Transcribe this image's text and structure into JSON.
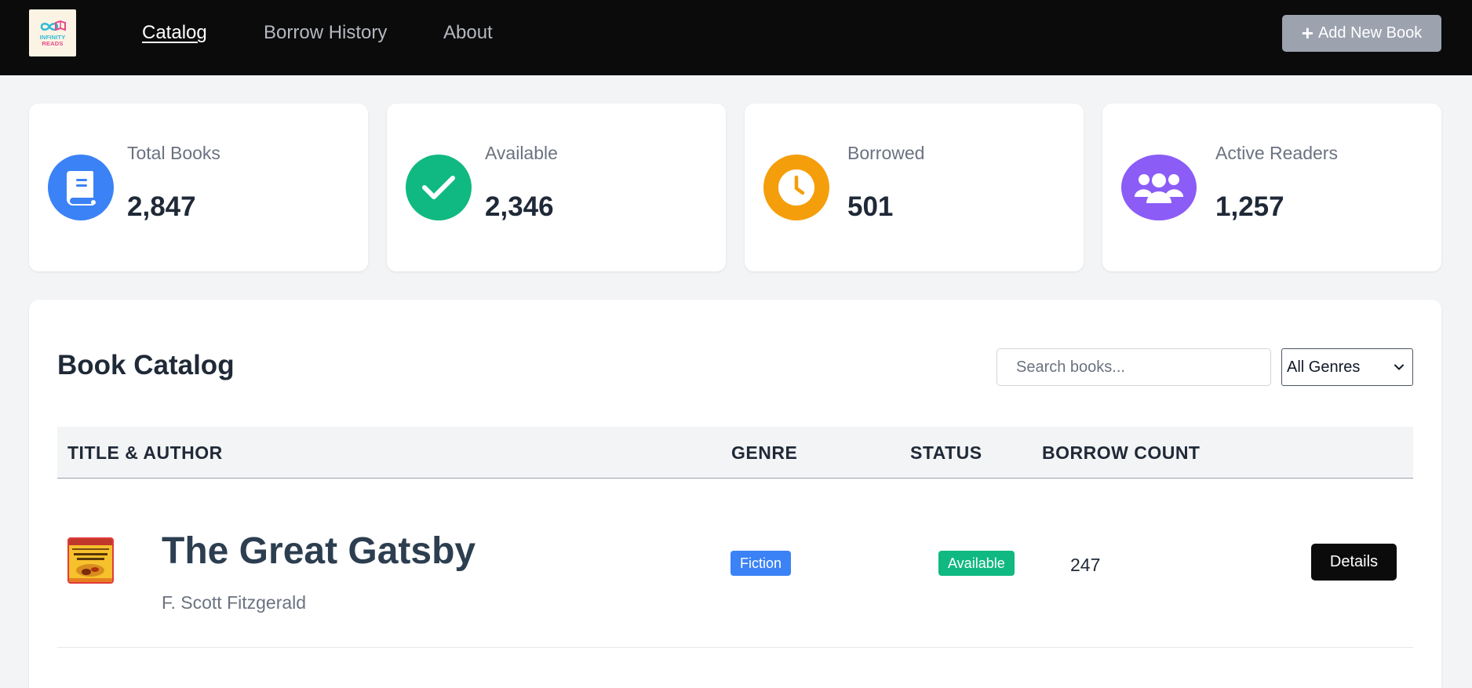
{
  "header": {
    "logo": {
      "line1": "INFINITY",
      "line2": "READS"
    },
    "nav": [
      {
        "label": "Catalog",
        "active": true
      },
      {
        "label": "Borrow History",
        "active": false
      },
      {
        "label": "About",
        "active": false
      }
    ],
    "add_button_label": "Add New Book"
  },
  "stats": [
    {
      "label": "Total Books",
      "value": "2,847",
      "icon": "book-icon",
      "color": "#3b82f6"
    },
    {
      "label": "Available",
      "value": "2,346",
      "icon": "check-icon",
      "color": "#10b981"
    },
    {
      "label": "Borrowed",
      "value": "501",
      "icon": "clock-icon",
      "color": "#f59e0b"
    },
    {
      "label": "Active Readers",
      "value": "1,257",
      "icon": "users-icon",
      "color": "#8b5cf6"
    }
  ],
  "catalog": {
    "title": "Book Catalog",
    "search": {
      "placeholder": "Search books...",
      "value": ""
    },
    "genre_filter": {
      "selected": "All Genres"
    },
    "columns": [
      "TITLE & AUTHOR",
      "GENRE",
      "STATUS",
      "BORROW COUNT"
    ],
    "rows": [
      {
        "title": "The Great Gatsby",
        "author": "F. Scott Fitzgerald",
        "genre": "Fiction",
        "status": "Available",
        "borrow_count": "247",
        "action_label": "Details"
      }
    ]
  },
  "colors": {
    "nav_bg": "#0b0b0b",
    "genre_badge": "#3b82f6",
    "status_available": "#10b981",
    "details_button": "#0b0b0b"
  }
}
